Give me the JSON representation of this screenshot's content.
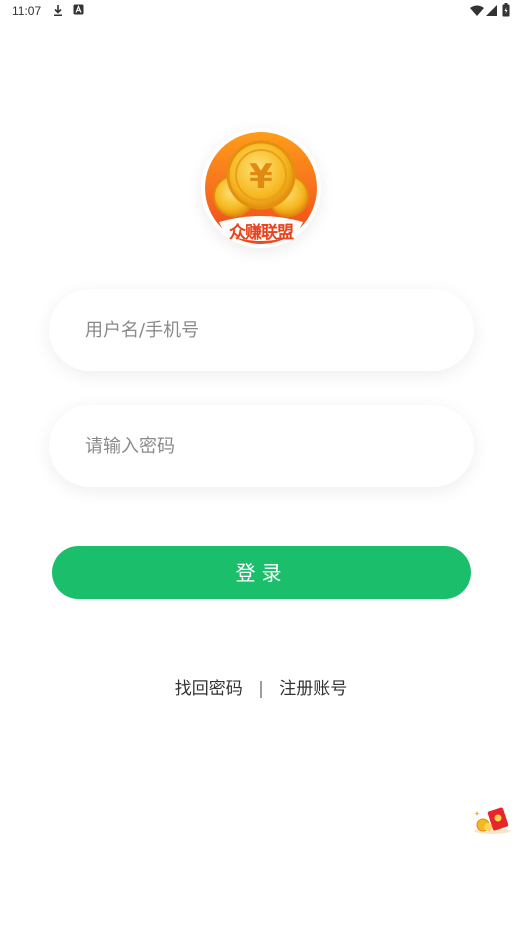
{
  "status_bar": {
    "time": "11:07",
    "icons": [
      "download-icon",
      "notification-a-icon",
      "wifi-icon",
      "signal-icon",
      "battery-icon"
    ]
  },
  "logo": {
    "icon": "gold-coin-logo-icon",
    "text": "众赚联盟",
    "colors": {
      "ring_outer": "#f0521f",
      "ring_inner": "#ff9a1f",
      "coin": "#f6b820",
      "coin_light": "#ffd760"
    }
  },
  "form": {
    "username_placeholder": "用户名/手机号",
    "password_placeholder": "请输入密码",
    "login_label": "登录"
  },
  "links": {
    "forgot_password": "找回密码",
    "separator": "|",
    "register": "注册账号"
  },
  "floating": {
    "icon": "red-envelope-icon"
  },
  "colors": {
    "accent": "#1bbf6b",
    "background": "#ffffff"
  }
}
